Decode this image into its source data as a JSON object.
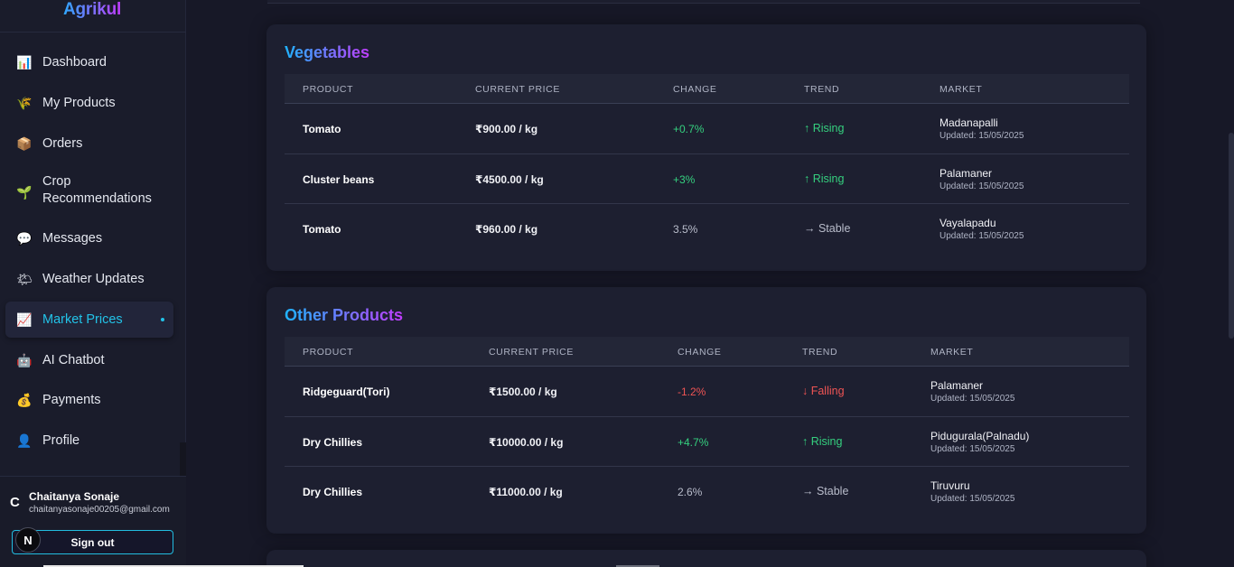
{
  "app": {
    "brand": "Agrikul"
  },
  "sidebar": {
    "items": [
      {
        "label": "Dashboard",
        "icon": "📊",
        "icon_name": "chart-icon"
      },
      {
        "label": "My Products",
        "icon": "🌾",
        "icon_name": "wheat-icon"
      },
      {
        "label": "Orders",
        "icon": "📦",
        "icon_name": "package-icon"
      },
      {
        "label": "Crop Recommendations",
        "line1": "Crop",
        "line2": "Recommendations",
        "icon": "🌱",
        "icon_name": "seedling-icon"
      },
      {
        "label": "Messages",
        "icon": "💬",
        "icon_name": "chat-icon"
      },
      {
        "label": "Weather Updates",
        "icon": "🌤",
        "icon_name": "weather-icon"
      },
      {
        "label": "Market Prices",
        "icon": "📈",
        "icon_name": "trend-chart-icon",
        "active": true
      },
      {
        "label": "AI Chatbot",
        "icon": "🤖",
        "icon_name": "robot-icon"
      },
      {
        "label": "Payments",
        "icon": "💰",
        "icon_name": "money-bag-icon"
      },
      {
        "label": "Profile",
        "icon": "👤",
        "icon_name": "user-icon"
      }
    ]
  },
  "user": {
    "initial": "C",
    "name": "Chaitanya Sonaje",
    "email": "chaitanyasonaje00205@gmail.com",
    "sign_out_label": "Sign out",
    "badge": "N"
  },
  "sections": [
    {
      "title": "Vegetables",
      "columns": [
        "PRODUCT",
        "CURRENT PRICE",
        "CHANGE",
        "TREND",
        "MARKET"
      ],
      "rows": [
        {
          "product": "Tomato",
          "price": "₹900.00 / kg",
          "change": "+0.7%",
          "change_type": "pos",
          "trend": "↑ Rising",
          "trend_type": "pos",
          "market": "Madanapalli",
          "updated": "Updated: 15/05/2025"
        },
        {
          "product": "Cluster beans",
          "price": "₹4500.00 / kg",
          "change": "+3%",
          "change_type": "pos",
          "trend": "↑ Rising",
          "trend_type": "pos",
          "market": "Palamaner",
          "updated": "Updated: 15/05/2025"
        },
        {
          "product": "Tomato",
          "price": "₹960.00 / kg",
          "change": "3.5%",
          "change_type": "neu",
          "trend": "→ Stable",
          "trend_type": "neu",
          "market": "Vayalapadu",
          "updated": "Updated: 15/05/2025"
        }
      ]
    },
    {
      "title": "Other Products",
      "columns": [
        "PRODUCT",
        "CURRENT PRICE",
        "CHANGE",
        "TREND",
        "MARKET"
      ],
      "rows": [
        {
          "product": "Ridgeguard(Tori)",
          "price": "₹1500.00 / kg",
          "change": "-1.2%",
          "change_type": "neg",
          "trend": "↓ Falling",
          "trend_type": "neg",
          "market": "Palamaner",
          "updated": "Updated: 15/05/2025"
        },
        {
          "product": "Dry Chillies",
          "price": "₹10000.00 / kg",
          "change": "+4.7%",
          "change_type": "pos",
          "trend": "↑ Rising",
          "trend_type": "pos",
          "market": "Pidugurala(Palnadu)",
          "updated": "Updated: 15/05/2025"
        },
        {
          "product": "Dry Chillies",
          "price": "₹11000.00 / kg",
          "change": "2.6%",
          "change_type": "neu",
          "trend": "→ Stable",
          "trend_type": "neu",
          "market": "Tiruvuru",
          "updated": "Updated: 15/05/2025"
        }
      ]
    }
  ],
  "colors": {
    "accent": "#22c3e8",
    "positive": "#35d07f",
    "negative": "#ef5454",
    "neutral": "#b9bdcb"
  }
}
